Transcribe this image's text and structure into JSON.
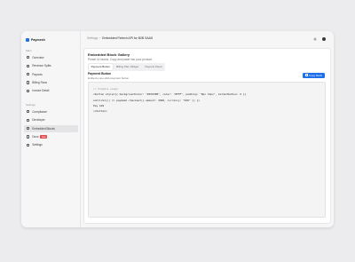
{
  "sidebar": {
    "brand": "Paymesh",
    "sections": [
      {
        "label": "Main"
      },
      {
        "label": "Settings"
      }
    ],
    "main_items": [
      {
        "label": "Overview",
        "icon": "home-icon",
        "active": false
      },
      {
        "label": "Revenue Splits",
        "icon": "split-icon",
        "active": false
      },
      {
        "label": "Payouts",
        "icon": "wallet-icon",
        "active": false
      },
      {
        "label": "Billing Runs",
        "icon": "repeat-icon",
        "active": false
      },
      {
        "label": "Invoice Detail",
        "icon": "file-icon",
        "active": false
      }
    ],
    "settings_items": [
      {
        "label": "Compliance",
        "icon": "shield-icon",
        "active": false
      },
      {
        "label": "Developer",
        "icon": "code-icon",
        "active": false
      },
      {
        "label": "Embedded Blocks",
        "icon": "blocks-icon",
        "active": true
      },
      {
        "label": "Docs",
        "icon": "book-icon",
        "active": false,
        "badge": "New"
      },
      {
        "label": "Settings",
        "icon": "gear-icon",
        "active": false
      }
    ]
  },
  "header": {
    "breadcrumb_parent": "Settings",
    "breadcrumb_sep": "/",
    "breadcrumb_current": "Embedded Fintech API for B2B SAAS"
  },
  "main": {
    "title": "Embedded Block Gallery",
    "subtitle": "Preset UI blocks. Copy and paste into your product.",
    "tabs": [
      {
        "label": "Payment Button",
        "active": true
      },
      {
        "label": "Billing Plan Widget",
        "active": false
      },
      {
        "label": "Payouts Panel",
        "active": false
      }
    ],
    "section_title": "Payment Button",
    "section_desc": "Embed a one-click payment button",
    "copy_label": "Copy block",
    "code_lines": [
      "// Example usage",
      "<button style={{ backgroundColor: \"#2563EB\", color: \"#FFF\", padding: \"8px 12px\", borderRadius: 6 }}",
      "onClick={() => paymesh.checkout({ amount: 4900, currency: \"USD\" }) }>",
      "Pay $49",
      "</button>"
    ]
  },
  "colors": {
    "accent": "#1f6feb",
    "badge": "#e5484d",
    "background": "#ececee"
  }
}
